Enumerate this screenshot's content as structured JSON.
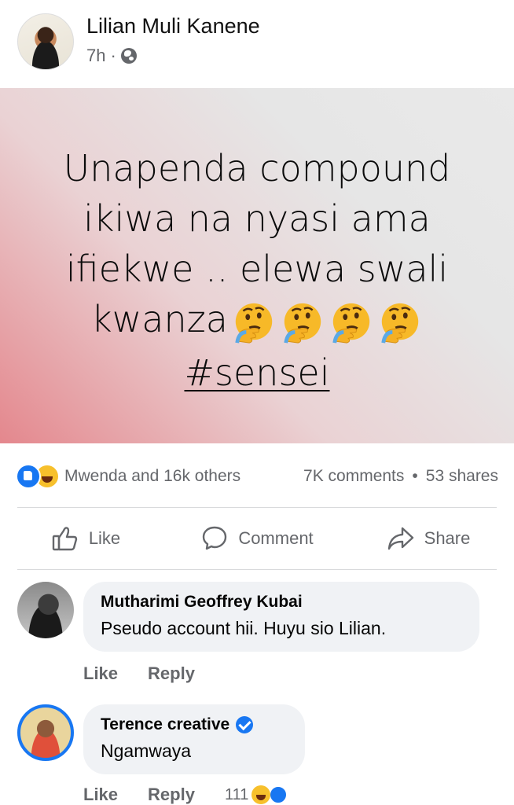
{
  "post": {
    "author": "Lilian Muli Kanene",
    "time": "7h",
    "separator": "·",
    "text_lines": [
      "Unapenda compound",
      "ikiwa na nyasi ama",
      "ifiekwe .. elewa swali",
      "kwanza"
    ],
    "hashtag": "#sensei",
    "emoji_name": "thinking-face-emoji",
    "emoji_count": 4,
    "background_colors": [
      "#e4878d",
      "#e9e9e9"
    ]
  },
  "stats": {
    "reactions": "Mwenda and 16k others",
    "comments": "7K comments",
    "dot": "•",
    "shares": "53 shares"
  },
  "actions": {
    "like": "Like",
    "comment": "Comment",
    "share": "Share"
  },
  "comments": [
    {
      "name": "Mutharimi Geoffrey Kubai",
      "text": "Pseudo account hii. Huyu sio Lilian.",
      "like_label": "Like",
      "reply_label": "Reply"
    },
    {
      "name": "Terence creative",
      "verified": true,
      "text": "Ngamwaya",
      "like_label": "Like",
      "reply_label": "Reply",
      "reaction_count": "111"
    }
  ],
  "colors": {
    "accent": "#1877f2",
    "muted_text": "#65676b",
    "bubble": "#f0f2f5"
  }
}
